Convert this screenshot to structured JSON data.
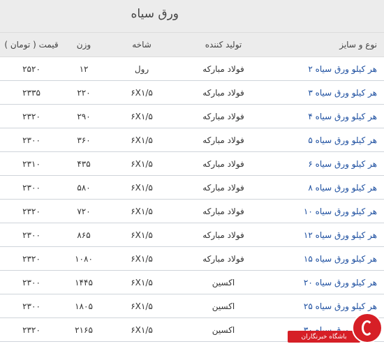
{
  "page": {
    "title": "ورق سیاه"
  },
  "table": {
    "headers": {
      "type": "نوع و سایز",
      "manufacturer": "تولید کننده",
      "branch": "شاخه",
      "weight": "وزن",
      "price": "قیمت ( تومان )"
    },
    "rows": [
      {
        "type": "هر کیلو ورق سیاه ۲",
        "manufacturer": "فولاد مبارکه",
        "branch": "رول",
        "weight": "۱۲",
        "price": "۲۵۲۰"
      },
      {
        "type": "هر کیلو ورق سیاه ۳",
        "manufacturer": "فولاد مبارکه",
        "branch": "۶X۱/۵",
        "weight": "۲۲۰",
        "price": "۲۳۳۵"
      },
      {
        "type": "هر کیلو ورق سیاه ۴",
        "manufacturer": "فولاد مبارکه",
        "branch": "۶X۱/۵",
        "weight": "۲۹۰",
        "price": "۲۳۲۰"
      },
      {
        "type": "هر کیلو ورق سیاه ۵",
        "manufacturer": "فولاد مبارکه",
        "branch": "۶X۱/۵",
        "weight": "۳۶۰",
        "price": "۲۳۰۰"
      },
      {
        "type": "هر کیلو ورق سیاه ۶",
        "manufacturer": "فولاد مبارکه",
        "branch": "۶X۱/۵",
        "weight": "۴۳۵",
        "price": "۲۳۱۰"
      },
      {
        "type": "هر کیلو ورق سیاه ۸",
        "manufacturer": "فولاد مبارکه",
        "branch": "۶X۱/۵",
        "weight": "۵۸۰",
        "price": "۲۳۰۰"
      },
      {
        "type": "هر کیلو ورق سیاه ۱۰",
        "manufacturer": "فولاد مبارکه",
        "branch": "۶X۱/۵",
        "weight": "۷۲۰",
        "price": "۲۳۲۰"
      },
      {
        "type": "هر کیلو ورق سیاه ۱۲",
        "manufacturer": "فولاد مبارکه",
        "branch": "۶X۱/۵",
        "weight": "۸۶۵",
        "price": "۲۳۰۰"
      },
      {
        "type": "هر کیلو ورق سیاه ۱۵",
        "manufacturer": "فولاد مبارکه",
        "branch": "۶X۱/۵",
        "weight": "۱۰۸۰",
        "price": "۲۳۲۰"
      },
      {
        "type": "هر کیلو ورق سیاه ۲۰",
        "manufacturer": "اکسین",
        "branch": "۶X۱/۵",
        "weight": "۱۴۴۵",
        "price": "۲۳۰۰"
      },
      {
        "type": "هر کیلو ورق سیاه ۲۵",
        "manufacturer": "اکسین",
        "branch": "۶X۱/۵",
        "weight": "۱۸۰۵",
        "price": "۲۳۰۰"
      },
      {
        "type": "هر کیلو ورق سیاه ۳۰",
        "manufacturer": "اکسین",
        "branch": "۶X۱/۵",
        "weight": "۲۱۶۵",
        "price": "۲۳۲۰"
      }
    ]
  },
  "watermark": {
    "label": "باشگاه خبرنگاران",
    "icon": "news-agency-logo-icon",
    "color": "#d61f26"
  }
}
